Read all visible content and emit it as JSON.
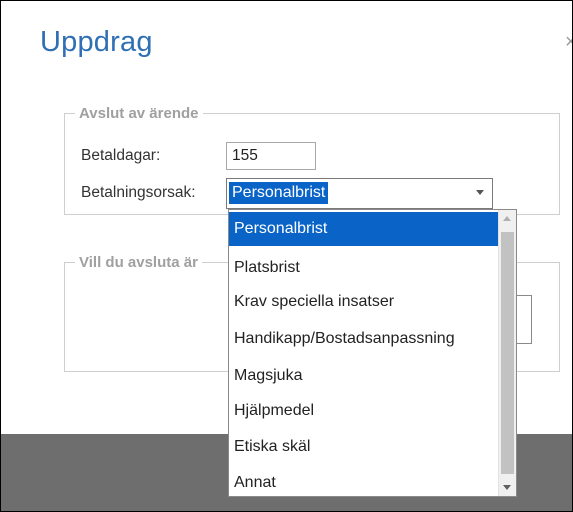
{
  "dialog": {
    "title": "Uppdrag",
    "close_glyph": "×"
  },
  "section_finish": {
    "legend": "Avslut av ärende",
    "paid_days_label": "Betaldagar:",
    "paid_days_value": "155",
    "payment_reason_label": "Betalningsorsak:",
    "payment_reason_selected": "Personalbrist"
  },
  "section_confirm": {
    "legend": "Vill du avsluta är"
  },
  "dropdown": {
    "options": [
      "Personalbrist",
      "Platsbrist",
      "Krav speciella insatser",
      "Handikapp/Bostadsanpassning",
      "Magsjuka",
      "Hjälpmedel",
      "Etiska skäl",
      "Annat"
    ],
    "selected_index": 0
  },
  "colors": {
    "title": "#2f6fb4",
    "selection": "#0a64c8",
    "overlay": "#6e6e6e"
  }
}
